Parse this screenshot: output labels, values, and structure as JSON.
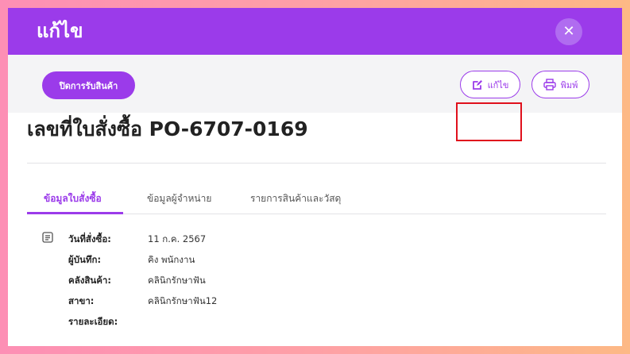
{
  "header": {
    "title": "แก้ไข",
    "close_symbol": "✕"
  },
  "toolbar": {
    "close_receive_label": "ปิดการรับสินค้า",
    "edit_label": "แก้ไข",
    "print_label": "พิมพ์"
  },
  "po": {
    "title": "เลขที่ใบสั่งซื้อ PO-6707-0169"
  },
  "tabs": [
    {
      "label": "ข้อมูลใบสั่งซื้อ",
      "active": true
    },
    {
      "label": "ข้อมูลผู้จำหน่าย",
      "active": false
    },
    {
      "label": "รายการสินค้าและวัสดุ",
      "active": false
    }
  ],
  "details": [
    {
      "label": "วันที่สั่งซื้อ:",
      "value": "11 ก.ค. 2567"
    },
    {
      "label": "ผู้บันทึก:",
      "value": "คิง พนักงาน"
    },
    {
      "label": "คลังสินค้า:",
      "value": "คลินิกรักษาฟัน"
    },
    {
      "label": "สาขา:",
      "value": "คลินิกรักษาฟัน12"
    },
    {
      "label": "รายละเอียด:",
      "value": ""
    }
  ],
  "colors": {
    "primary": "#9b3bea",
    "highlight": "#e0101c"
  }
}
